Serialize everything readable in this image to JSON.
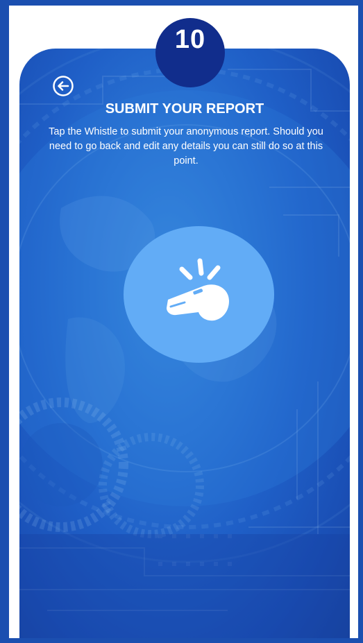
{
  "step": {
    "number": "10"
  },
  "header": {
    "back_icon": "arrow-left-circle-icon",
    "title": "SUBMIT YOUR REPORT"
  },
  "main": {
    "description": "Tap the Whistle to submit your anonymous report. Should you need to go back and edit any details you can still do so at this point.",
    "whistle_icon": "whistle-icon"
  },
  "colors": {
    "page_background": "#1b4fb0",
    "badge": "#112d8c",
    "whistle_circle": "#62acf6",
    "card_gradient_center": "#3d8fe0",
    "card_gradient_edge": "#17449f"
  }
}
